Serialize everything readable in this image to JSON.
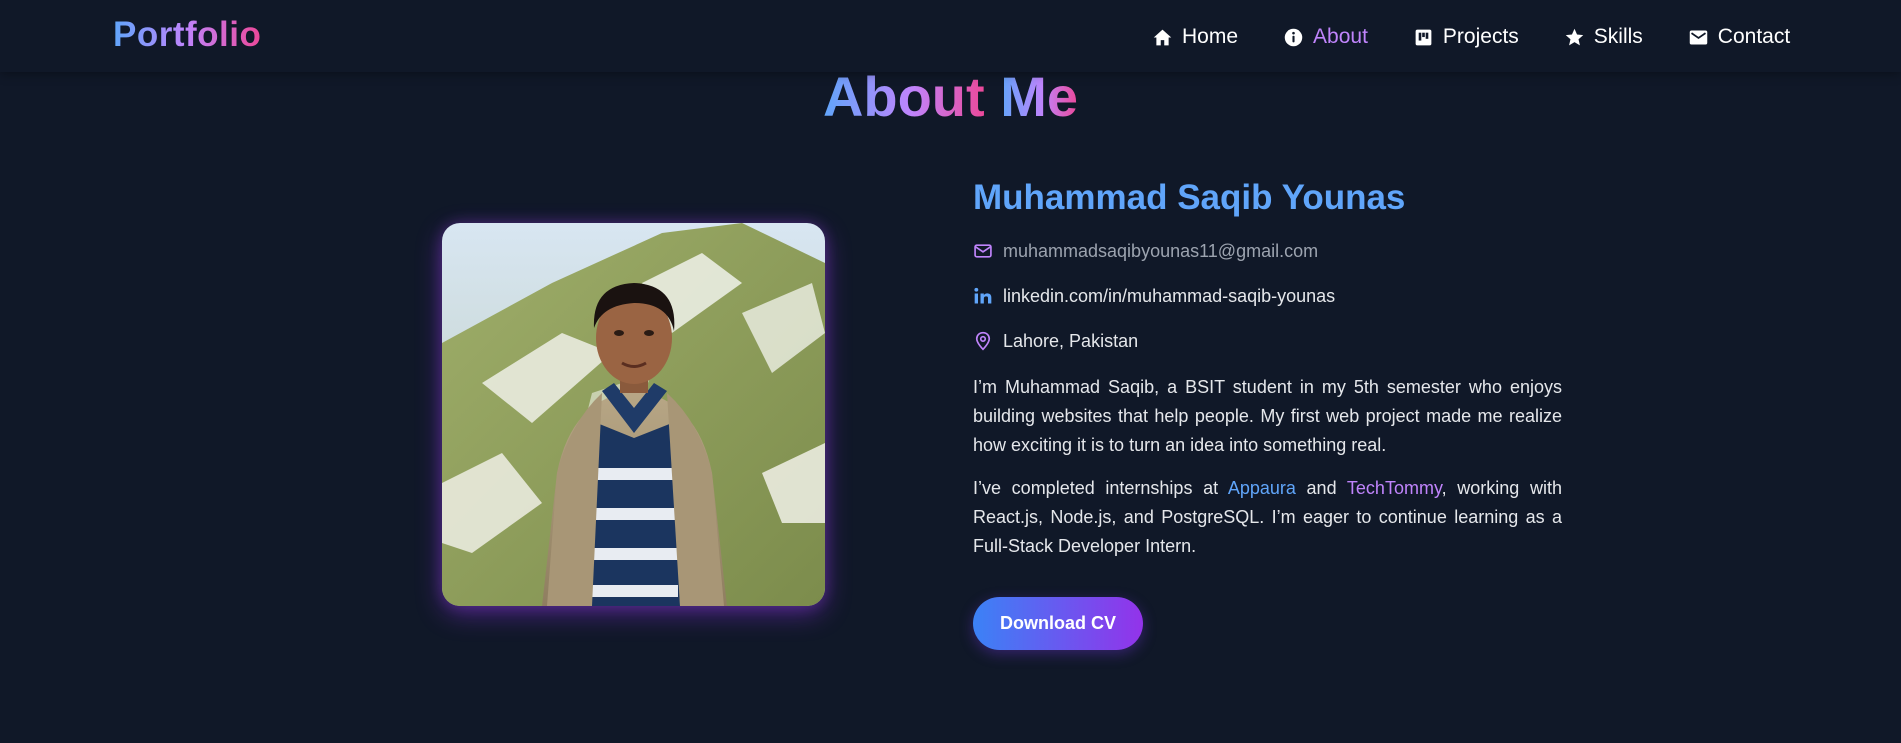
{
  "nav": {
    "logo": "Portfolio",
    "items": [
      {
        "label": "Home",
        "icon": "home-icon",
        "active": false
      },
      {
        "label": "About",
        "icon": "info-icon",
        "active": true
      },
      {
        "label": "Projects",
        "icon": "projects-icon",
        "active": false
      },
      {
        "label": "Skills",
        "icon": "star-icon",
        "active": false
      },
      {
        "label": "Contact",
        "icon": "mail-icon",
        "active": false
      }
    ]
  },
  "about": {
    "title_part1": "About",
    "title_part2": "Me",
    "name": "Muhammad Saqib Younas",
    "email": "muhammadsaqibyounas11@gmail.com",
    "linkedin": "linkedin.com/in/muhammad-saqib-younas",
    "location": "Lahore, Pakistan",
    "para1": "I’m Muhammad Saqib, a BSIT student in my 5th semester who enjoys building websites that help people. My first web project made me realize how exciting it is to turn an idea into something real.",
    "para2_start": "I’ve completed internships at ",
    "company1": "Appaura",
    "para2_and": " and ",
    "company2": "TechTommy",
    "para2_end": ", working with React.js, Node.js, and PostgreSQL. I’m eager to continue learning as a Full-Stack Developer Intern.",
    "cv_label": "Download CV"
  },
  "colors": {
    "background": "#101828",
    "accent_blue": "#60a5fa",
    "accent_purple": "#c084fc",
    "accent_pink": "#ec4899"
  }
}
